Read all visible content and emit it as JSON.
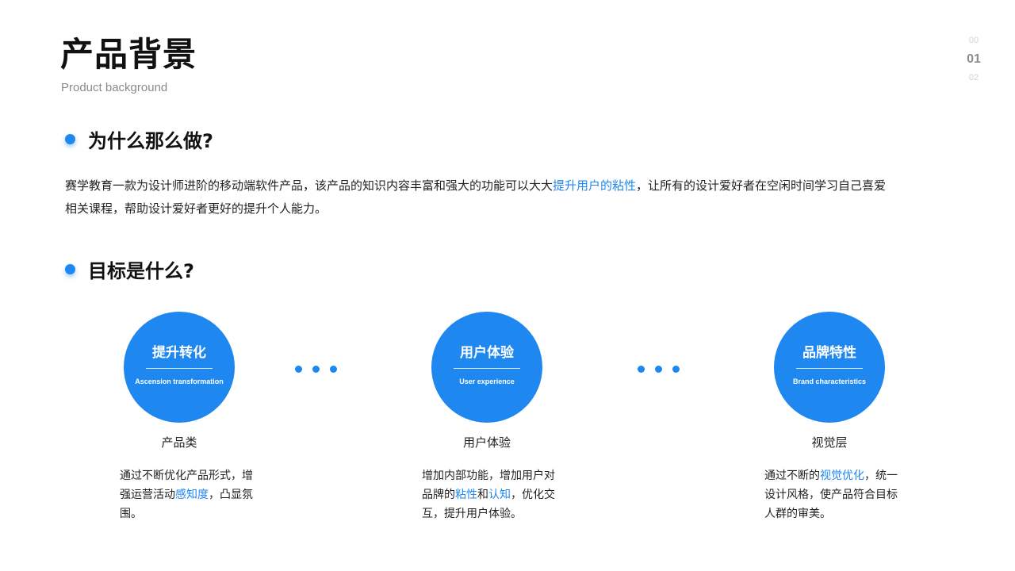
{
  "header": {
    "title": "产品背景",
    "subtitle": "Product background",
    "pager": [
      "00",
      "01",
      "02"
    ]
  },
  "section_why": {
    "heading": "为什么那么做?",
    "paragraph": {
      "before": "赛学教育一款为设计师进阶的移动端软件产品，该产品的知识内容丰富和强大的功能可以大大",
      "highlight": "提升用户的粘性",
      "after": "，让所有的设计爱好者在空闲时间学习自己喜爱相关课程，帮助设计爱好者更好的提升个人能力。"
    }
  },
  "section_goal": {
    "heading": "目标是什么?",
    "goals": [
      {
        "title_cn": "提升转化",
        "title_en": "Ascension transformation",
        "name": "产品类",
        "desc": [
          {
            "t": "通过不断优化产品形式，增强运营活动",
            "hl": false
          },
          {
            "t": "感知度",
            "hl": true
          },
          {
            "t": "，凸显氛围。",
            "hl": false
          }
        ]
      },
      {
        "title_cn": "用户体验",
        "title_en": "User experience",
        "name": "用户体验",
        "desc": [
          {
            "t": "增加内部功能，增加用户对品牌的",
            "hl": false
          },
          {
            "t": "粘性",
            "hl": true
          },
          {
            "t": "和",
            "hl": false
          },
          {
            "t": "认知",
            "hl": true
          },
          {
            "t": "，优化交互，提升用户体验。",
            "hl": false
          }
        ]
      },
      {
        "title_cn": "品牌特性",
        "title_en": "Brand characteristics",
        "name": "视觉层",
        "desc": [
          {
            "t": "通过不断的",
            "hl": false
          },
          {
            "t": "视觉优化",
            "hl": true
          },
          {
            "t": "，统一设计风格，使产品符合目标人群的审美。",
            "hl": false
          }
        ]
      }
    ]
  },
  "colors": {
    "accent": "#1e87f0",
    "text": "#222222",
    "muted": "#8a8a8a"
  }
}
